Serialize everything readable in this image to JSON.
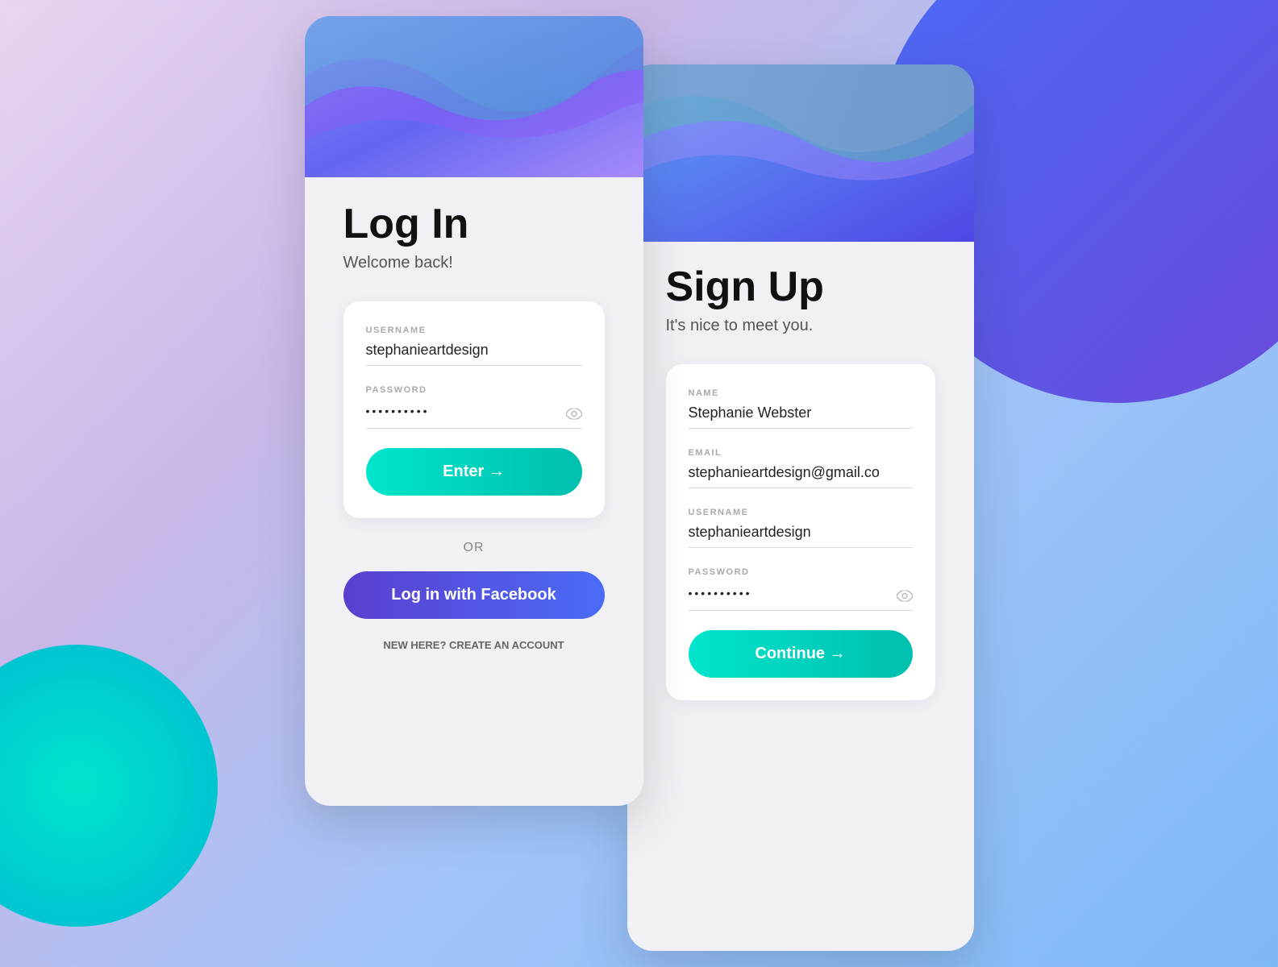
{
  "background": {
    "color": "#e8d5f0"
  },
  "login": {
    "title": "Log In",
    "subtitle": "Welcome back!",
    "username_label": "USERNAME",
    "username_value": "stephanieartdesign",
    "password_label": "PASSWORD",
    "password_value": "••••••••••",
    "enter_button": "Enter →",
    "or_text": "OR",
    "facebook_button": "Log in with Facebook",
    "new_here_text": "New here?",
    "create_account_text": "CREATE AN ACCOUNT"
  },
  "signup": {
    "title": "Sign Up",
    "subtitle": "It's nice to meet you.",
    "name_label": "NAME",
    "name_value": "Stephanie Webster",
    "email_label": "EMAIL",
    "email_value": "stephanieartdesign@gmail.co",
    "username_label": "USERNAME",
    "username_value": "stephanieartdesign",
    "password_label": "PASSWORD",
    "password_value": "••••••••••",
    "continue_button": "Continue →"
  }
}
